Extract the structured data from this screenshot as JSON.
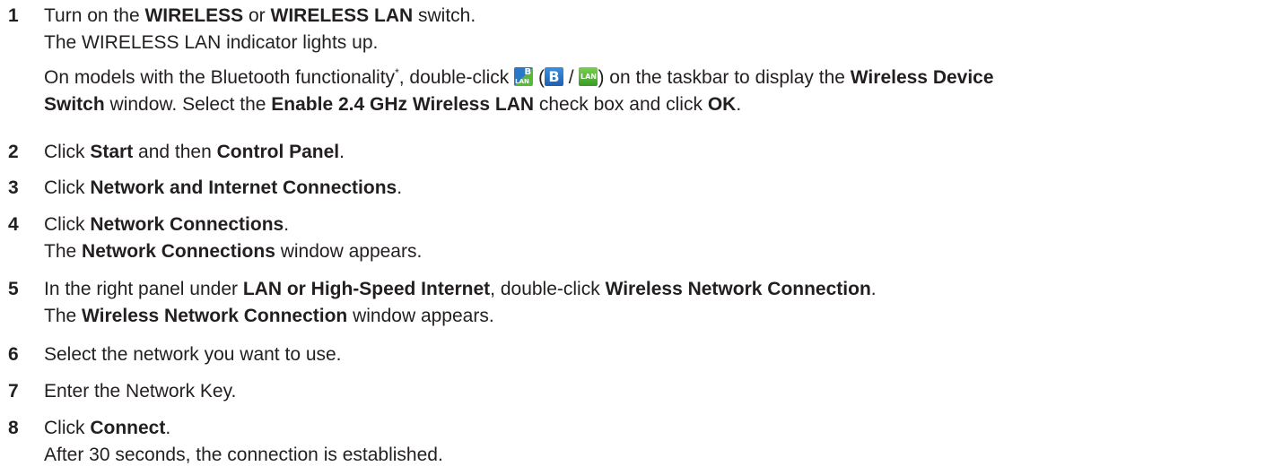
{
  "steps": [
    {
      "num": "1",
      "lines": [
        {
          "a": "Turn on the ",
          "b1": "WIRELESS",
          "c": " or ",
          "b2": "WIRELESS LAN",
          "d": " switch."
        },
        {
          "text": "The WIRELESS LAN indicator lights up."
        }
      ],
      "note": {
        "t1": "On models with the Bluetooth functionality",
        "sup": "*",
        "t2": ", double-click ",
        "t3": " (",
        "t4": " / ",
        "t5": ") on the taskbar to display the ",
        "b1": "Wireless Device",
        "b2": "Switch",
        "t6": " window. Select the ",
        "b3": "Enable 2.4 GHz Wireless LAN",
        "t7": " check box and click ",
        "b4": "OK",
        "t8": "."
      },
      "icons": {
        "combo": {
          "name": "bluetooth-wlan-icon",
          "top": "B",
          "bottom": "LAN"
        },
        "bt": {
          "name": "bluetooth-icon",
          "label": "B"
        },
        "lan": {
          "name": "wlan-icon",
          "label": "LAN"
        }
      }
    },
    {
      "num": "2",
      "a": "Click ",
      "b1": "Start",
      "c": " and then ",
      "b2": "Control Panel",
      "d": "."
    },
    {
      "num": "3",
      "a": "Click ",
      "b1": "Network and Internet Connections",
      "d": "."
    },
    {
      "num": "4",
      "a": "Click ",
      "b1": "Network Connections",
      "d": ".",
      "l2a": "The ",
      "l2b": "Network Connections",
      "l2c": " window appears."
    },
    {
      "num": "5",
      "a": "In the right panel under ",
      "b1": "LAN or High-Speed Internet",
      "c": ", double-click ",
      "b2": "Wireless Network Connection",
      "d": ".",
      "l2a": "The ",
      "l2b": "Wireless Network Connection",
      "l2c": " window appears."
    },
    {
      "num": "6",
      "text": "Select the network you want to use."
    },
    {
      "num": "7",
      "text": "Enter the Network Key."
    },
    {
      "num": "8",
      "a": "Click ",
      "b1": "Connect",
      "d": ".",
      "l2": "After 30 seconds, the connection is established."
    }
  ]
}
